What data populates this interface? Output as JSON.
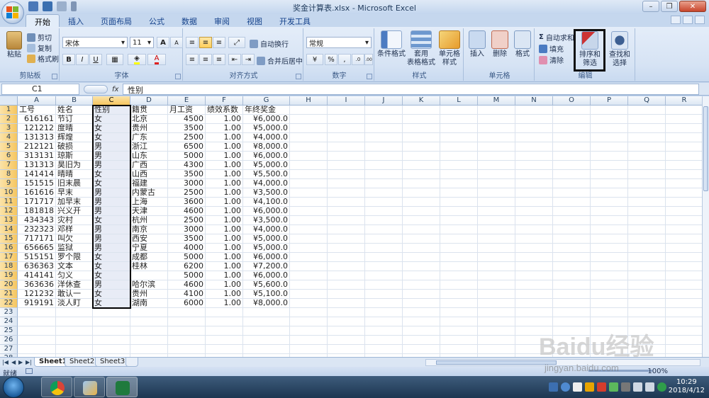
{
  "window": {
    "title": "奖金计算表.xlsx - Microsoft Excel"
  },
  "tabs": [
    "开始",
    "插入",
    "页面布局",
    "公式",
    "数据",
    "审阅",
    "视图",
    "开发工具"
  ],
  "ribbon": {
    "clipboard": {
      "label": "剪贴板",
      "paste": "粘贴",
      "cut": "剪切",
      "copy": "复制",
      "format_painter": "格式刷"
    },
    "font": {
      "label": "字体",
      "name": "宋体",
      "size": "11",
      "bold": "B",
      "italic": "I",
      "underline": "U",
      "grow": "A",
      "shrink": "A",
      "font_color": "A"
    },
    "alignment": {
      "label": "对齐方式",
      "wrap": "自动换行",
      "merge": "合并后居中"
    },
    "number": {
      "label": "数字",
      "format": "常规",
      "percent": "%",
      "comma": ",",
      "dec_inc": ".0",
      "dec_dec": ".00"
    },
    "styles": {
      "label": "样式",
      "cond_format": "条件格式",
      "table_format_1": "套用",
      "table_format_2": "表格格式",
      "cell_style_1": "单元格",
      "cell_style_2": "样式"
    },
    "cells": {
      "label": "单元格",
      "insert": "插入",
      "delete": "删除",
      "format": "格式"
    },
    "editing": {
      "label": "编辑",
      "autosum": "自动求和",
      "fill": "填充",
      "clear": "清除",
      "sort_filter_1": "排序和",
      "sort_filter_2": "筛选",
      "find_1": "查找和",
      "find_2": "选择"
    }
  },
  "formula_bar": {
    "name_box": "C1",
    "fx": "fx",
    "content": "性别"
  },
  "columns": [
    "A",
    "B",
    "C",
    "D",
    "E",
    "F",
    "G",
    "H",
    "I",
    "J",
    "K",
    "L",
    "M",
    "N",
    "O",
    "P",
    "Q",
    "R"
  ],
  "rows": [
    "1",
    "2",
    "3",
    "4",
    "5",
    "6",
    "7",
    "8",
    "9",
    "10",
    "11",
    "12",
    "13",
    "14",
    "15",
    "16",
    "17",
    "18",
    "19",
    "20",
    "21",
    "22",
    "23",
    "24",
    "25",
    "26",
    "27",
    "28"
  ],
  "table": {
    "headers": [
      "工号",
      "姓名",
      "性别",
      "籍贯",
      "月工资",
      "绩效系数",
      "年终奖金"
    ],
    "records": [
      [
        "616161",
        "节订",
        "女",
        "北京",
        "4500",
        "1.00",
        "¥6,000.0"
      ],
      [
        "121212",
        "度晴",
        "女",
        "贵州",
        "3500",
        "1.00",
        "¥5,000.0"
      ],
      [
        "131313",
        "辉煌",
        "女",
        "广东",
        "2500",
        "1.00",
        "¥4,000.0"
      ],
      [
        "212121",
        "破损",
        "男",
        "浙江",
        "6500",
        "1.00",
        "¥8,000.0"
      ],
      [
        "313131",
        "琼斯",
        "男",
        "山东",
        "5000",
        "1.00",
        "¥6,000.0"
      ],
      [
        "131313",
        "昊旧为",
        "男",
        "广西",
        "4300",
        "1.00",
        "¥5,000.0"
      ],
      [
        "141414",
        "晴晴",
        "女",
        "山西",
        "3500",
        "1.00",
        "¥5,500.0"
      ],
      [
        "151515",
        "旧末晨",
        "女",
        "福建",
        "3000",
        "1.00",
        "¥4,000.0"
      ],
      [
        "161616",
        "早末",
        "男",
        "内蒙古",
        "2500",
        "1.00",
        "¥3,500.0"
      ],
      [
        "171717",
        "加早末",
        "男",
        "上海",
        "3600",
        "1.00",
        "¥4,100.0"
      ],
      [
        "181818",
        "兴义开",
        "男",
        "天津",
        "4600",
        "1.00",
        "¥6,000.0"
      ],
      [
        "434343",
        "灾村",
        "女",
        "杭州",
        "2500",
        "1.00",
        "¥3,500.0"
      ],
      [
        "232323",
        "邓样",
        "男",
        "南京",
        "3000",
        "1.00",
        "¥4,000.0"
      ],
      [
        "717171",
        "叫欠",
        "男",
        "西安",
        "3500",
        "1.00",
        "¥5,000.0"
      ],
      [
        "656665",
        "监狱",
        "男",
        "宁夏",
        "4000",
        "1.00",
        "¥5,000.0"
      ],
      [
        "515151",
        "罗个限",
        "女",
        "成都",
        "5000",
        "1.00",
        "¥6,000.0"
      ],
      [
        "636363",
        "文本",
        "女",
        "桂林",
        "6200",
        "1.00",
        "¥7,200.0"
      ],
      [
        "414141",
        "匀义",
        "女",
        "",
        "5000",
        "1.00",
        "¥6,000.0"
      ],
      [
        "363636",
        "洋休查",
        "男",
        "哈尔滨",
        "4600",
        "1.00",
        "¥5,600.0"
      ],
      [
        "121232",
        "敢认一",
        "女",
        "贵州",
        "4100",
        "1.00",
        "¥5,100.0"
      ],
      [
        "919191",
        "淡人盯",
        "女",
        "湖南",
        "6000",
        "1.00",
        "¥8,000.0"
      ]
    ]
  },
  "sheets": [
    "Sheet1",
    "Sheet2",
    "Sheet3"
  ],
  "status": {
    "text": "就绪",
    "zoom": "100%"
  },
  "clock": {
    "time": "10:29",
    "date": "2018/4/12"
  },
  "watermark": {
    "main": "Baidu经验",
    "sub": "jingyan.baidu.com"
  }
}
